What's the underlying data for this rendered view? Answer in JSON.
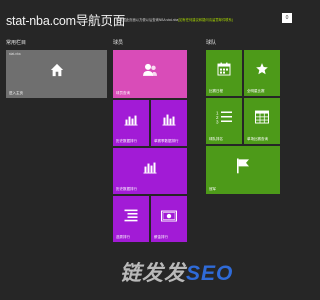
{
  "header": {
    "title": "stat-nba.com导航页面",
    "subtitle": "请收藏此页面以方便以后查询NBA stat-nba",
    "subtitle_link": "(如有任何建议和疑问请留意邮件联系)",
    "close_label": "0"
  },
  "sections": {
    "common": {
      "title": "常用栏目",
      "tiles": [
        {
          "label": "进入主页",
          "corner": "stat-nba",
          "icon": "home-icon"
        }
      ]
    },
    "players": {
      "title": "球员",
      "tiles": [
        {
          "label": "球员查询",
          "icon": "people-icon"
        },
        {
          "label": "历史数据排行",
          "icon": "bar-chart-icon"
        },
        {
          "label": "单赛季数据排行",
          "icon": "bar-chart-icon"
        },
        {
          "label": "历史数据排行",
          "icon": "bar-chart-icon"
        },
        {
          "label": "选秀排行",
          "icon": "list-icon"
        },
        {
          "label": "薪金排行",
          "icon": "money-icon"
        }
      ]
    },
    "teams": {
      "title": "球队",
      "tiles": [
        {
          "label": "比赛日程",
          "icon": "calendar-icon"
        },
        {
          "label": "全明星比赛",
          "icon": "star-icon"
        },
        {
          "label": "球队排名",
          "icon": "ranking-icon"
        },
        {
          "label": "单场比赛查询",
          "icon": "grid-icon"
        },
        {
          "label": "冠军",
          "icon": "flag-icon"
        }
      ]
    }
  },
  "colors": {
    "background": "#262626",
    "gray_tile": "#6f6f6f",
    "pink_tile": "#d94cb8",
    "purple_tile": "#a21bd6",
    "green_tile": "#4d9a19",
    "link": "#a6d400"
  },
  "watermark": {
    "text": "链发发",
    "brand": "SEO"
  }
}
